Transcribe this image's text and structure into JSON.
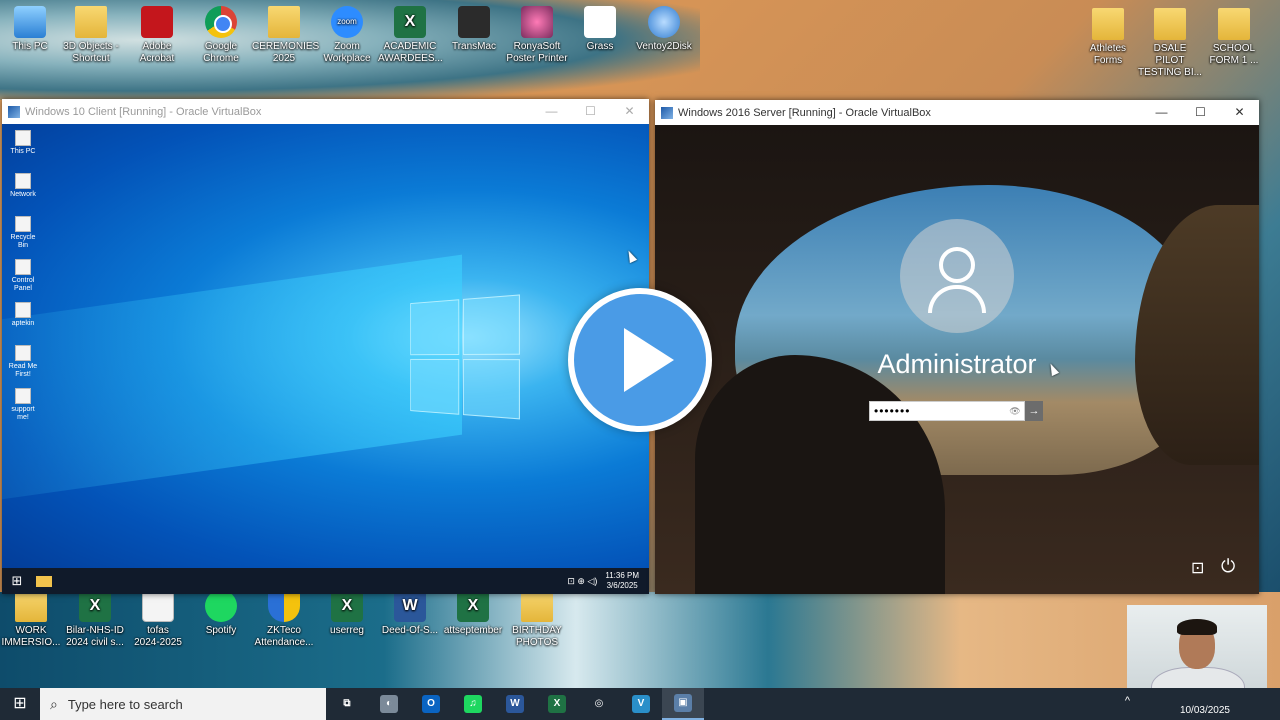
{
  "desktop": {
    "top_icons": [
      {
        "label": "This PC",
        "type": "pc",
        "icon": "computer-icon"
      },
      {
        "label": "3D Objects -\nShortcut",
        "type": "folder",
        "icon": "folder-icon"
      },
      {
        "label": "Adobe\nAcrobat",
        "type": "pdf",
        "icon": "acrobat-icon"
      },
      {
        "label": "Google\nChrome",
        "type": "chrome",
        "icon": "chrome-icon"
      },
      {
        "label": "CEREMONIES\n2025",
        "type": "folder",
        "icon": "folder-icon"
      },
      {
        "label": "Zoom\nWorkplace",
        "type": "zoom",
        "icon": "zoom-icon"
      },
      {
        "label": "ACADEMIC\nAWARDEES...",
        "type": "excel",
        "icon": "excel-icon"
      },
      {
        "label": "TransMac",
        "type": "mac",
        "icon": "transmac-icon"
      },
      {
        "label": "RonyaSoft\nPoster Printer",
        "type": "butterfly",
        "icon": "ronyasoft-icon"
      },
      {
        "label": "Grass",
        "type": "grass",
        "icon": "grass-icon"
      },
      {
        "label": "Ventoy2Disk",
        "type": "ventoy",
        "icon": "ventoy-icon"
      }
    ],
    "right_icons": [
      {
        "label": "Athletes\nForms",
        "type": "folder"
      },
      {
        "label": "DSALE PILOT\nTESTING BI...",
        "type": "folder"
      },
      {
        "label": "SCHOOL\nFORM 1 ...",
        "type": "folder"
      }
    ],
    "bottom_icons": [
      {
        "label": "WORK\nIMMERSIO...",
        "type": "folder"
      },
      {
        "label": "Bilar-NHS-ID\n2024 civil s...",
        "type": "excel"
      },
      {
        "label": "tofas\n2024-2025",
        "type": "doc"
      },
      {
        "label": "Spotify",
        "type": "spotify"
      },
      {
        "label": "ZKTeco\nAttendance...",
        "type": "shield"
      },
      {
        "label": "userreg",
        "type": "excel"
      },
      {
        "label": "Deed-Of-S...",
        "type": "word"
      },
      {
        "label": "attseptember",
        "type": "excel"
      },
      {
        "label": "BIRTHDAY\nPHOTOS",
        "type": "folder"
      }
    ]
  },
  "vm1": {
    "title": "Windows 10 Client [Running] - Oracle VirtualBox",
    "minimize": "—",
    "maximize": "☐",
    "close": "✕",
    "desk_icons": [
      "This PC",
      "Network",
      "Recycle Bin",
      "Control Panel",
      "aptekin",
      "Read Me First!",
      "support me!"
    ],
    "clock_time": "11:36 PM",
    "clock_date": "3/6/2025",
    "start": "⊞",
    "tray": "⊡ ⊕ ◁)"
  },
  "vm2": {
    "title": "Windows 2016 Server [Running] - Oracle VirtualBox",
    "minimize": "—",
    "maximize": "☐",
    "close": "✕",
    "username": "Administrator",
    "password_mask": "•••••••",
    "reveal": "👁",
    "submit": "→",
    "ease": "⊡",
    "power": "⏻"
  },
  "taskbar": {
    "start": "⊞",
    "search_icon": "⌕",
    "search_placeholder": "Type here to search",
    "apps": [
      {
        "name": "task-view",
        "glyph": "⧉",
        "bg": "transparent"
      },
      {
        "name": "app-bird",
        "glyph": "◐",
        "bg": "#7b8a99"
      },
      {
        "name": "outlook",
        "glyph": "O",
        "bg": "#0a64c2"
      },
      {
        "name": "spotify",
        "glyph": "♫",
        "bg": "#1ed760"
      },
      {
        "name": "word",
        "glyph": "W",
        "bg": "#2b579a"
      },
      {
        "name": "excel",
        "glyph": "X",
        "bg": "#1f7244"
      },
      {
        "name": "network-app",
        "glyph": "◎",
        "bg": "transparent"
      },
      {
        "name": "virtualbox",
        "glyph": "V",
        "bg": "#2a8fc9"
      },
      {
        "name": "virtualbox-active",
        "glyph": "▣",
        "bg": "#5b7fa8"
      }
    ],
    "chevron": "^",
    "date": "10/03/2025"
  }
}
